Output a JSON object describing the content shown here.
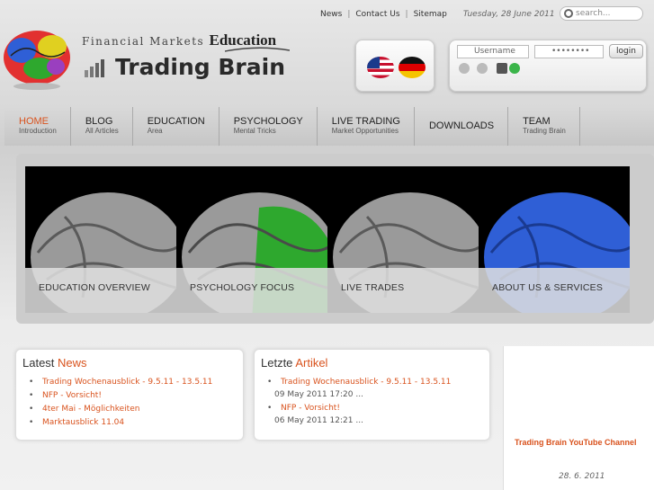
{
  "logo": {
    "top_text": "Financial Markets",
    "top_bold": "Education",
    "main": "Trading Brain"
  },
  "topbar": {
    "links": [
      "News",
      "Contact Us",
      "Sitemap"
    ],
    "separator": "|",
    "date": "Tuesday, 28 June 2011"
  },
  "search": {
    "placeholder": "search..."
  },
  "login": {
    "username_placeholder": "Username",
    "password_value": "••••••••",
    "button": "login"
  },
  "nav": [
    {
      "title": "HOME",
      "sub": "Introduction",
      "active": true
    },
    {
      "title": "BLOG",
      "sub": "All Articles"
    },
    {
      "title": "EDUCATION",
      "sub": "Area"
    },
    {
      "title": "PSYCHOLOGY",
      "sub": "Mental Tricks"
    },
    {
      "title": "LIVE TRADING",
      "sub": "Market Opportunities"
    },
    {
      "title": "DOWNLOADS",
      "sub": ""
    },
    {
      "title": "TEAM",
      "sub": "Trading Brain"
    }
  ],
  "slider": [
    {
      "caption": "EDUCATION OVERVIEW",
      "accent": "#999999"
    },
    {
      "caption": "PSYCHOLOGY FOCUS",
      "accent": "#2ea82e"
    },
    {
      "caption": "LIVE TRADES",
      "accent": "#999999"
    },
    {
      "caption": "ABOUT US & SERVICES",
      "accent": "#2f5fd6"
    }
  ],
  "latest_news": {
    "title_a": "Latest",
    "title_b": "News",
    "items": [
      "Trading Wochenausblick - 9.5.11 - 13.5.11",
      "NFP - Vorsicht!",
      "4ter Mai - Möglichkeiten",
      "Marktausblick 11.04"
    ]
  },
  "latest_articles": {
    "title_a": "Letzte",
    "title_b": "Artikel",
    "items": [
      {
        "title": "Trading Wochenausblick - 9.5.11 - 13.5.11",
        "date": "09 May 2011 17:20 ..."
      },
      {
        "title": "NFP - Vorsicht!",
        "date": "06 May 2011 12:21 ..."
      }
    ]
  },
  "sidebar": {
    "youtube": "Trading Brain YouTube Channel",
    "date": "28. 6. 2011"
  },
  "colors": {
    "accent": "#d9531e"
  }
}
